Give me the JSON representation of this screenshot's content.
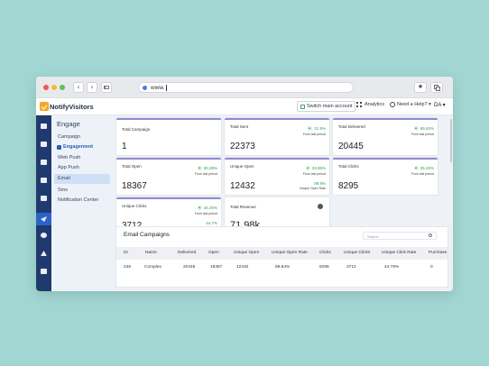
{
  "browser": {
    "url": "www.",
    "back_icon": "‹",
    "forward_icon": "›",
    "star_icon": "★"
  },
  "appbar": {
    "logo_text": "NotifyVisitors",
    "switch_label": "Switch main account",
    "analytics_label": "Analytics",
    "help_label": "Need a Help? ▾",
    "user_initials": "DA ▾"
  },
  "menu": {
    "title": "Engage",
    "items": [
      "Campaign",
      "Engagement",
      "Web Push",
      "App Push",
      "Email",
      "Sms",
      "Notification Center"
    ],
    "selected": "Email"
  },
  "cards": {
    "total_campaigns": {
      "label": "Total Campaign",
      "value": "1"
    },
    "total_sent": {
      "label": "Total Sent",
      "value": "22373",
      "pct": "31.9%",
      "sub": "From last period"
    },
    "total_delivered": {
      "label": "Total Delivered",
      "value": "20445",
      "pct": "96.62%",
      "sub": "From last period"
    },
    "total_open": {
      "label": "Total Open",
      "value": "18367",
      "pct": "90.39%",
      "sub": "From last period"
    },
    "unique_open": {
      "label": "Unique Open",
      "value": "12432",
      "pct": "33.95%",
      "sub": "From last period",
      "pct2": "89.8%",
      "sub2": "Unique Open Rate"
    },
    "total_clicks": {
      "label": "Total Clicks",
      "value": "8295",
      "pct": "35.25%",
      "sub": "From last period"
    },
    "unique_clicks": {
      "label": "Unique Clicks",
      "value": "3712",
      "pct": "34.25%",
      "sub": "From last period",
      "pct2": "44.7%",
      "sub2": "Unique Click Rate"
    },
    "total_revenue": {
      "label": "Total Revenue",
      "value": "71.98k"
    }
  },
  "campaigns": {
    "title": "Email Campaigns",
    "search_placeholder": "Search",
    "columns": [
      "ID",
      "Name",
      "Delivered",
      "Open",
      "Unique Open",
      "Unique Open Rate",
      "Clicks",
      "Unique Clicks",
      "Unique Click Rate",
      "Purchase"
    ],
    "rows": [
      [
        "246",
        "Complex",
        "20445",
        "18367",
        "12432",
        "89.84%",
        "8295",
        "3712",
        "44.75%",
        "0"
      ]
    ]
  },
  "colors": {
    "background": "#a2d6d2",
    "iconbar": "#1f3a6e",
    "accent": "#2d63c8",
    "positive": "#2fa14f",
    "card_top": "#8f8ad0"
  },
  "icons": {
    "iconbar": [
      "dashboard-icon",
      "home-icon",
      "chart-icon",
      "users-icon",
      "layout-icon",
      "engage-send-icon",
      "target-icon",
      "alert-icon",
      "document-icon"
    ]
  }
}
